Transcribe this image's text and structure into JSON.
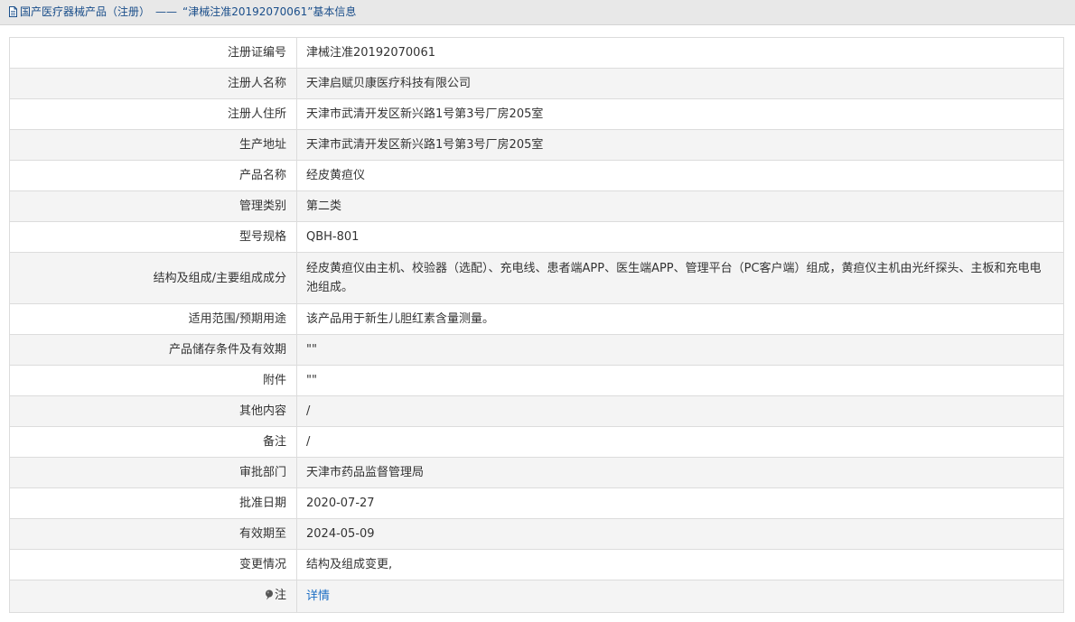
{
  "breadcrumb": {
    "icon": "document-icon",
    "category": "国产医疗器械产品（注册）",
    "separator": "——",
    "record": "“津械注准20192070061”基本信息"
  },
  "colors": {
    "link": "#1e6fc4",
    "breadcrumb": "#1a4e8a",
    "row_alt": "#f4f4f4",
    "border": "#dcdcdc"
  },
  "rows": [
    {
      "label": "注册证编号",
      "value": "津械注准20192070061"
    },
    {
      "label": "注册人名称",
      "value": "天津启赋贝康医疗科技有限公司"
    },
    {
      "label": "注册人住所",
      "value": "天津市武清开发区新兴路1号第3号厂房205室"
    },
    {
      "label": "生产地址",
      "value": "天津市武清开发区新兴路1号第3号厂房205室"
    },
    {
      "label": "产品名称",
      "value": "经皮黄疸仪"
    },
    {
      "label": "管理类别",
      "value": "第二类"
    },
    {
      "label": "型号规格",
      "value": "QBH-801"
    },
    {
      "label": "结构及组成/主要组成成分",
      "value": "经皮黄疸仪由主机、校验器（选配）、充电线、患者端APP、医生端APP、管理平台（PC客户端）组成，黄疸仪主机由光纤探头、主板和充电电池组成。"
    },
    {
      "label": "适用范围/预期用途",
      "value": "该产品用于新生儿胆红素含量测量。"
    },
    {
      "label": "产品储存条件及有效期",
      "value": "\"\""
    },
    {
      "label": "附件",
      "value": "\"\""
    },
    {
      "label": "其他内容",
      "value": "/"
    },
    {
      "label": "备注",
      "value": "/"
    },
    {
      "label": "审批部门",
      "value": "天津市药品监督管理局"
    },
    {
      "label": "批准日期",
      "value": "2020-07-27"
    },
    {
      "label": "有效期至",
      "value": "2024-05-09"
    },
    {
      "label": "变更情况",
      "value": "结构及组成变更,"
    }
  ],
  "note_row": {
    "icon": "pin-icon",
    "label": "注",
    "link_text": "详情"
  }
}
